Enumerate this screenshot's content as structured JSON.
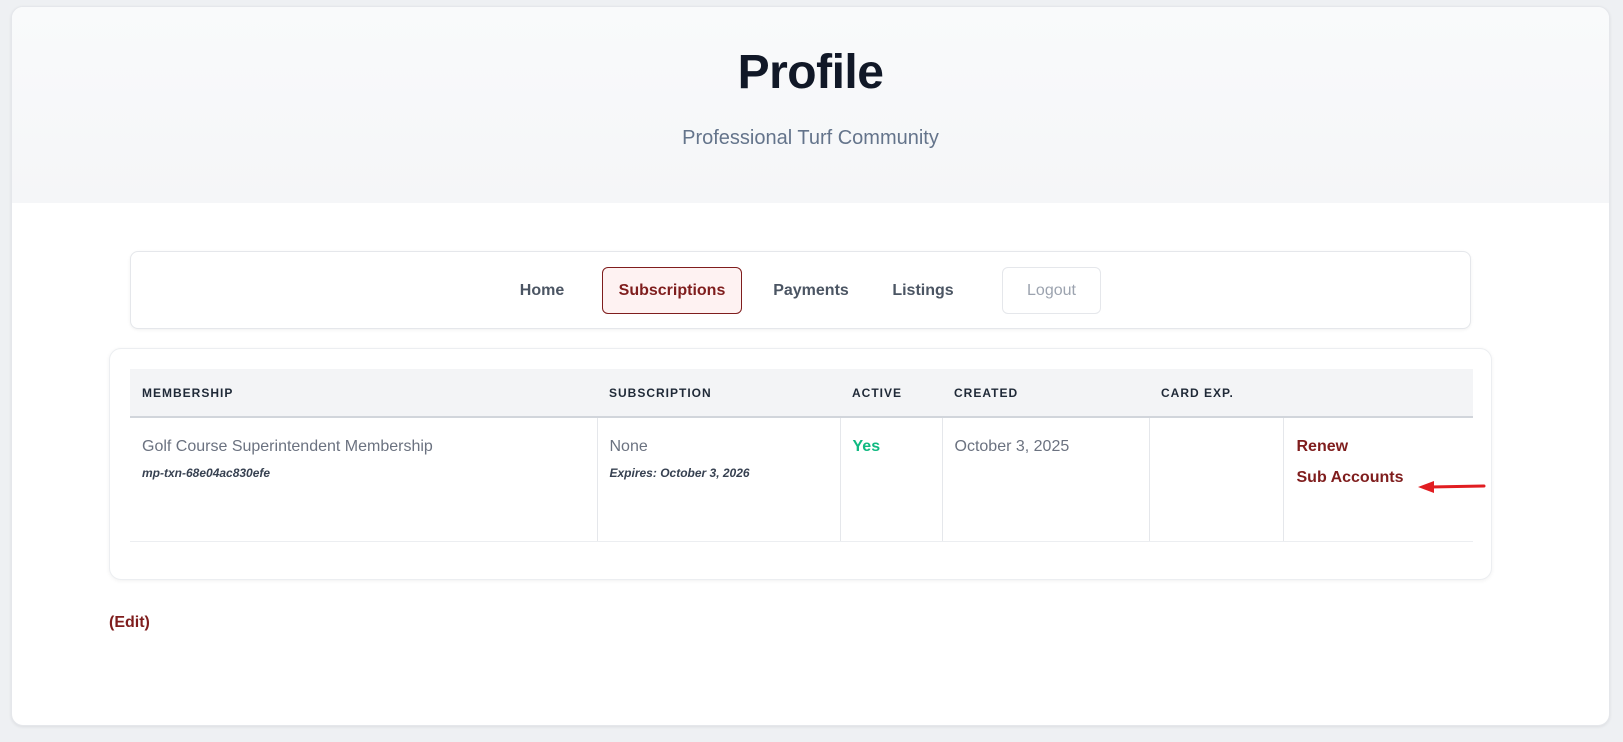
{
  "header": {
    "title": "Profile",
    "subtitle": "Professional Turf Community"
  },
  "nav": {
    "items": [
      {
        "label": "Home"
      },
      {
        "label": "Subscriptions",
        "active": true
      },
      {
        "label": "Payments"
      },
      {
        "label": "Listings"
      },
      {
        "label": "Logout"
      }
    ]
  },
  "table": {
    "headers": [
      "MEMBERSHIP",
      "SUBSCRIPTION",
      "ACTIVE",
      "CREATED",
      "CARD EXP.",
      ""
    ],
    "rows": [
      {
        "membership": "Golf Course Superintendent Membership",
        "transaction_id": "mp-txn-68e04ac830efe",
        "subscription": "None",
        "expires": "Expires: October 3, 2026",
        "active": "Yes",
        "created": "October 3, 2025",
        "card_exp": "",
        "actions": [
          "Renew",
          "Sub Accounts"
        ]
      }
    ]
  },
  "edit_label": "(Edit)",
  "colors": {
    "brand": "#7f1d1d",
    "active_green": "#10b981",
    "annotation_arrow": "#e11d21"
  }
}
